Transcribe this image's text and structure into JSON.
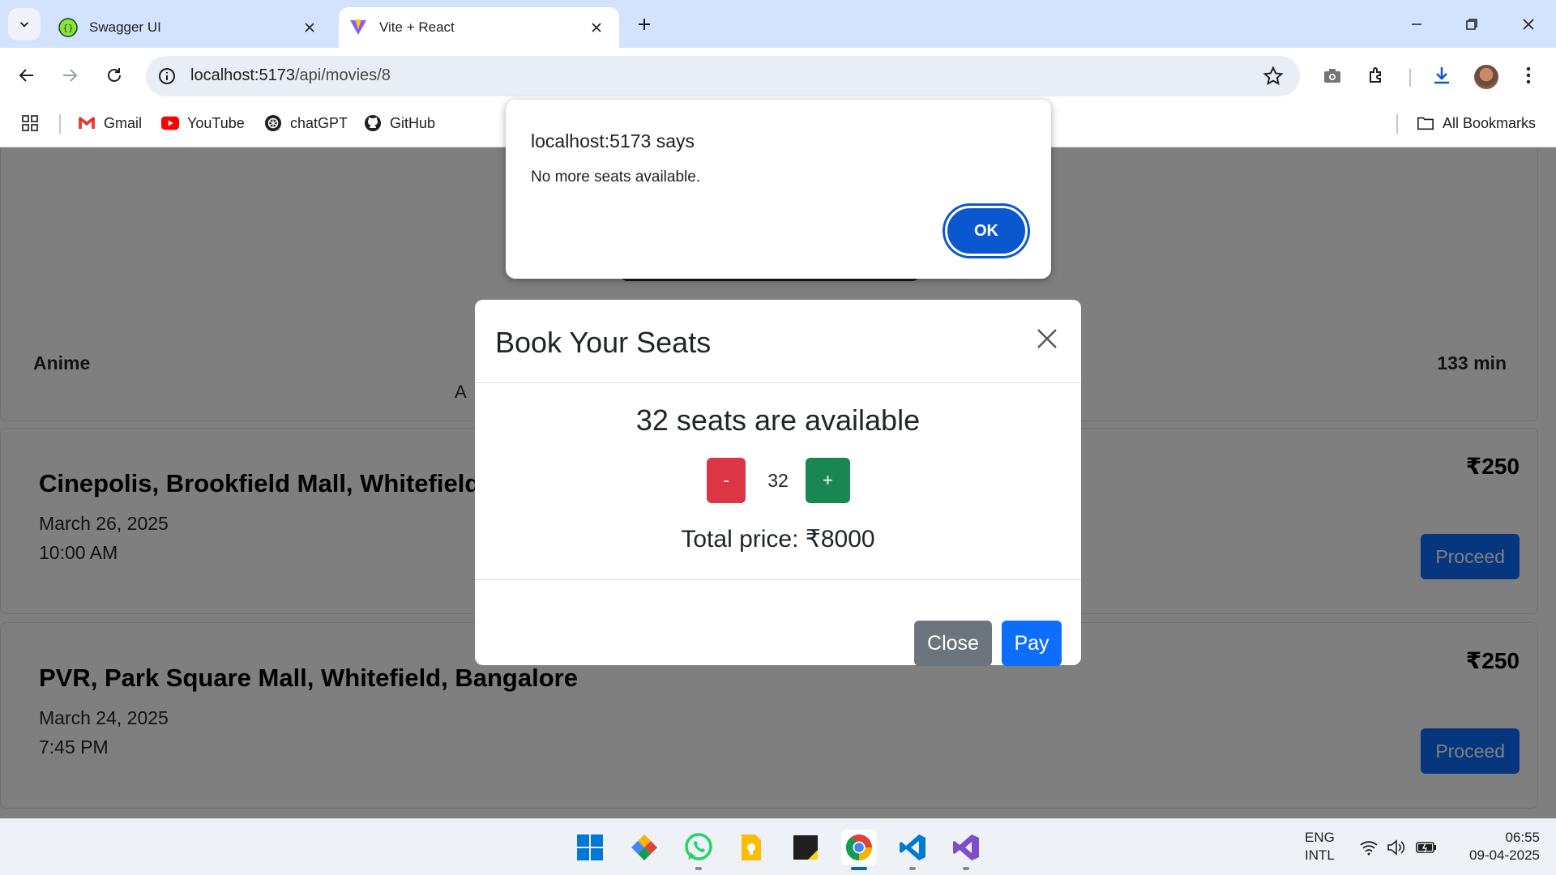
{
  "browser": {
    "tabs": [
      {
        "title": "Swagger UI",
        "active": false
      },
      {
        "title": "Vite + React",
        "active": true
      }
    ],
    "url_host": "localhost:5173",
    "url_path": "/api/movies/8",
    "bookmarks": [
      "Gmail",
      "YouTube",
      "chatGPT",
      "GitHub"
    ],
    "all_bookmarks": "All Bookmarks"
  },
  "page": {
    "movie": {
      "genre": "Anime",
      "duration": "133 min",
      "description_visible": "A"
    },
    "showtimes": [
      {
        "theater": "Cinepolis, Brookfield Mall, Whitefield",
        "date": "March 26, 2025",
        "time": "10:00 AM",
        "price": "₹250",
        "action": "Proceed"
      },
      {
        "theater": "PVR, Park Square Mall, Whitefield, Bangalore",
        "date": "March 24, 2025",
        "time": "7:45 PM",
        "price": "₹250",
        "action": "Proceed"
      }
    ]
  },
  "modal": {
    "title": "Book Your Seats",
    "available": "32 seats are available",
    "minus": "-",
    "count": "32",
    "plus": "+",
    "total": "Total price: ₹8000",
    "close": "Close",
    "pay": "Pay"
  },
  "alert": {
    "title": "localhost:5173 says",
    "message": "No more seats available.",
    "ok": "OK"
  },
  "taskbar": {
    "lang_1": "ENG",
    "lang_2": "INTL",
    "time": "06:55",
    "date": "09-04-2025"
  },
  "colors": {
    "primary": "#0d6efd",
    "danger": "#dc3545",
    "success": "#198754",
    "secondary": "#6c757d",
    "chrome_accent": "#0b57d0"
  }
}
